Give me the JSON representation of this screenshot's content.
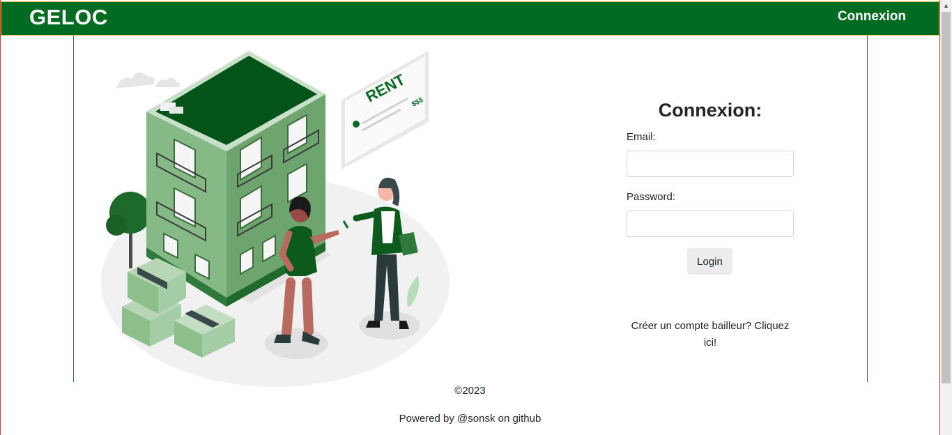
{
  "navbar": {
    "brand": "GELOC",
    "login_link": "Connexion"
  },
  "illustration": {
    "sign_text": "RENT",
    "price_text": "$$$"
  },
  "login_form": {
    "title": "Connexion:",
    "email_label": "Email:",
    "email_value": "",
    "password_label": "Password:",
    "password_value": "",
    "submit_label": "Login",
    "signup_text": "Créer un compte bailleur? Cliquez ici!"
  },
  "footer": {
    "copyright": "©2023",
    "powered_by": "Powered by @sonsk on github"
  },
  "colors": {
    "brand_green": "#016b22",
    "dark_green": "#0a5a1e",
    "building_green": "#8fbf8f"
  }
}
